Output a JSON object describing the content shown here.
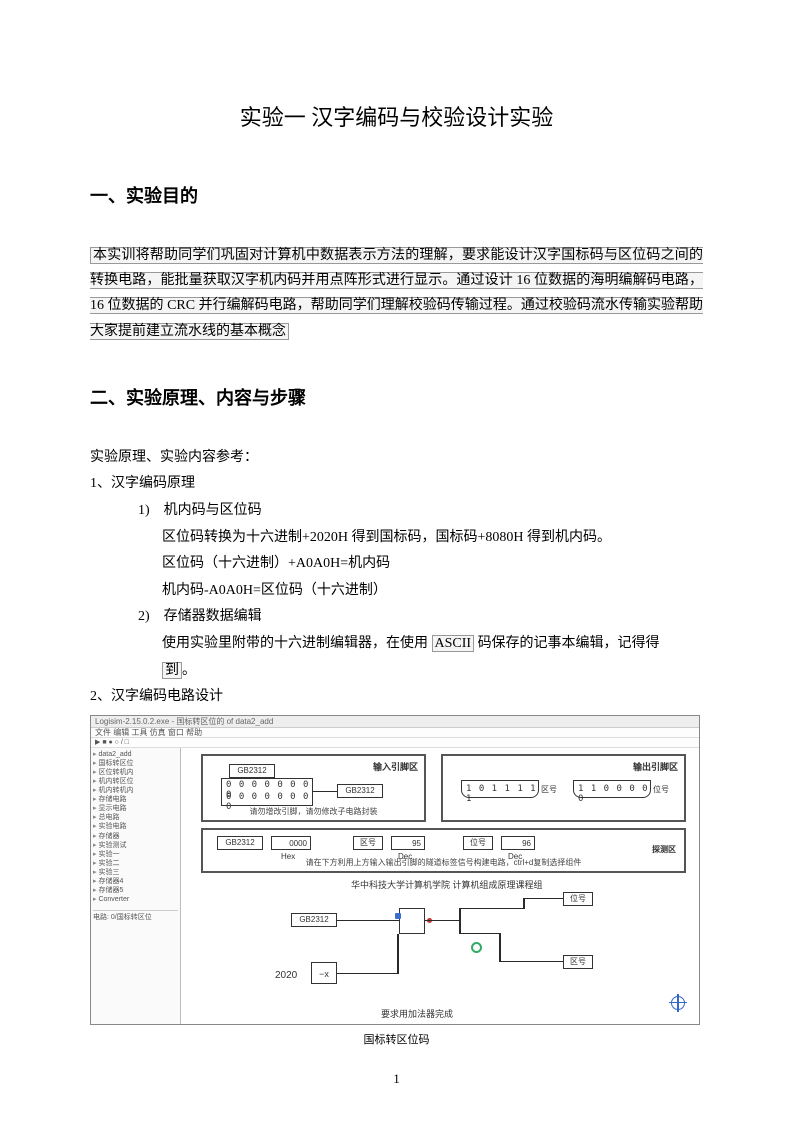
{
  "title": "实验一 汉字编码与校验设计实验",
  "section1": {
    "heading": "一、实验目的",
    "paragraph": "本实训将帮助同学们巩固对计算机中数据表示方法的理解，要求能设计汉字国标码与区位码之间的转换电路，能批量获取汉字机内码并用点阵形式进行显示。通过设计 16 位数据的海明编解码电路，16 位数据的 CRC 并行编解码电路，帮助同学们理解校验码传输过程。通过校验码流水传输实验帮助大家提前建立流水线的基本概念"
  },
  "section2": {
    "heading": "二、实验原理、内容与步骤",
    "intro": "实验原理、实验内容参考：",
    "item1": "1、汉字编码原理",
    "item1_1": "1)　机内码与区位码",
    "item1_1_a": "区位码转换为十六进制+2020H 得到国标码，国标码+8080H 得到机内码。",
    "item1_1_b": "区位码（十六进制）+A0A0H=机内码",
    "item1_1_c": "机内码-A0A0H=区位码（十六进制）",
    "item1_2": "2)　存储器数据编辑",
    "item1_2_a_pre": "使用实验里附带的十六进制编辑器，在使用 ",
    "item1_2_a_hl": "ASCII",
    "item1_2_a_post": " 码保存的记事本编辑，记得得",
    "item1_2_b_hl": "到",
    "item1_2_b_post": "。",
    "item2": "2、汉字编码电路设计"
  },
  "diagram": {
    "titlebar": "Logisim-2.15.0.2.exe - 国标转区位的 of data2_add",
    "menubar": "文件 编辑 工具 仿真 窗口 帮助",
    "toolbar": "▶ ■ ● ○ / □",
    "sidebar_items": [
      "data2_add",
      "国标转区位",
      "区位转机内",
      "机内转区位",
      "机内转机内",
      "存储电路",
      "显示电路",
      "总电路",
      "实验电路",
      "存储器",
      "实验测试",
      "实验一",
      "实验二",
      "实验三",
      "存储器4",
      "存储器5",
      "Converter"
    ],
    "sidebar_footer": "电路: 0/国标转区位",
    "panel_a_title": "输入引脚区",
    "panel_a_gb": "GB2312",
    "panel_a_pins": "0 0 0 0 0 0 0 0",
    "panel_a_pins2": "0 0 0 0 0 0 0 0",
    "panel_a_note": "请勿增改引脚，请勿修改子电路封装",
    "panel_b_title": "输出引脚区",
    "panel_b_pins1": "1 0 1 1 1 1 1",
    "panel_b_lbl1": "区号",
    "panel_b_pins2": "1 1 0 0 0 0 0",
    "panel_b_lbl2": "位号",
    "panel_c_gb": "GB2312",
    "panel_c_hex_val": "0000",
    "panel_c_hex_lbl": "Hex",
    "panel_c_qu": "区号",
    "panel_c_qu_val": "95",
    "panel_c_qu_lbl": "Dec",
    "panel_c_wei": "位号",
    "panel_c_wei_val": "96",
    "panel_c_wei_lbl": "Dec",
    "panel_c_right": "探测区",
    "panel_c_note": "请在下方利用上方输入输出引脚的隧道标签信号构建电路，ctrl+d复制选择组件",
    "mid_text": "华中科技大学计算机学院 计算机组成原理课程组",
    "lower_gb": "GB2312",
    "lower_const": "2020",
    "lower_neg": "−x",
    "lower_wei": "位号",
    "lower_qu": "区号",
    "bottom_text": "要求用加法器完成"
  },
  "caption": "国标转区位码",
  "page_number": "1"
}
